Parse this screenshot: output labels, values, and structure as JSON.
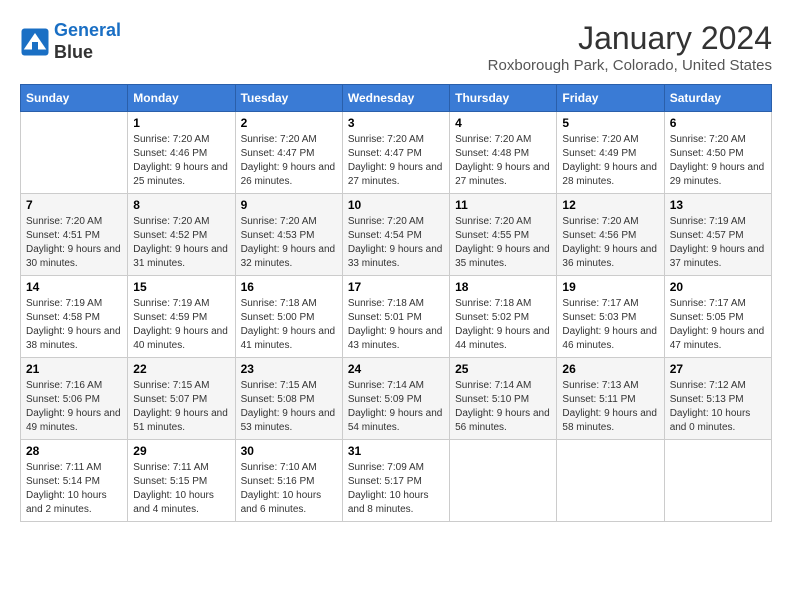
{
  "header": {
    "logo_line1": "General",
    "logo_line2": "Blue",
    "month_title": "January 2024",
    "location": "Roxborough Park, Colorado, United States"
  },
  "weekdays": [
    "Sunday",
    "Monday",
    "Tuesday",
    "Wednesday",
    "Thursday",
    "Friday",
    "Saturday"
  ],
  "weeks": [
    [
      {
        "day": "",
        "sunrise": "",
        "sunset": "",
        "daylight": ""
      },
      {
        "day": "1",
        "sunrise": "Sunrise: 7:20 AM",
        "sunset": "Sunset: 4:46 PM",
        "daylight": "Daylight: 9 hours and 25 minutes."
      },
      {
        "day": "2",
        "sunrise": "Sunrise: 7:20 AM",
        "sunset": "Sunset: 4:47 PM",
        "daylight": "Daylight: 9 hours and 26 minutes."
      },
      {
        "day": "3",
        "sunrise": "Sunrise: 7:20 AM",
        "sunset": "Sunset: 4:47 PM",
        "daylight": "Daylight: 9 hours and 27 minutes."
      },
      {
        "day": "4",
        "sunrise": "Sunrise: 7:20 AM",
        "sunset": "Sunset: 4:48 PM",
        "daylight": "Daylight: 9 hours and 27 minutes."
      },
      {
        "day": "5",
        "sunrise": "Sunrise: 7:20 AM",
        "sunset": "Sunset: 4:49 PM",
        "daylight": "Daylight: 9 hours and 28 minutes."
      },
      {
        "day": "6",
        "sunrise": "Sunrise: 7:20 AM",
        "sunset": "Sunset: 4:50 PM",
        "daylight": "Daylight: 9 hours and 29 minutes."
      }
    ],
    [
      {
        "day": "7",
        "sunrise": "Sunrise: 7:20 AM",
        "sunset": "Sunset: 4:51 PM",
        "daylight": "Daylight: 9 hours and 30 minutes."
      },
      {
        "day": "8",
        "sunrise": "Sunrise: 7:20 AM",
        "sunset": "Sunset: 4:52 PM",
        "daylight": "Daylight: 9 hours and 31 minutes."
      },
      {
        "day": "9",
        "sunrise": "Sunrise: 7:20 AM",
        "sunset": "Sunset: 4:53 PM",
        "daylight": "Daylight: 9 hours and 32 minutes."
      },
      {
        "day": "10",
        "sunrise": "Sunrise: 7:20 AM",
        "sunset": "Sunset: 4:54 PM",
        "daylight": "Daylight: 9 hours and 33 minutes."
      },
      {
        "day": "11",
        "sunrise": "Sunrise: 7:20 AM",
        "sunset": "Sunset: 4:55 PM",
        "daylight": "Daylight: 9 hours and 35 minutes."
      },
      {
        "day": "12",
        "sunrise": "Sunrise: 7:20 AM",
        "sunset": "Sunset: 4:56 PM",
        "daylight": "Daylight: 9 hours and 36 minutes."
      },
      {
        "day": "13",
        "sunrise": "Sunrise: 7:19 AM",
        "sunset": "Sunset: 4:57 PM",
        "daylight": "Daylight: 9 hours and 37 minutes."
      }
    ],
    [
      {
        "day": "14",
        "sunrise": "Sunrise: 7:19 AM",
        "sunset": "Sunset: 4:58 PM",
        "daylight": "Daylight: 9 hours and 38 minutes."
      },
      {
        "day": "15",
        "sunrise": "Sunrise: 7:19 AM",
        "sunset": "Sunset: 4:59 PM",
        "daylight": "Daylight: 9 hours and 40 minutes."
      },
      {
        "day": "16",
        "sunrise": "Sunrise: 7:18 AM",
        "sunset": "Sunset: 5:00 PM",
        "daylight": "Daylight: 9 hours and 41 minutes."
      },
      {
        "day": "17",
        "sunrise": "Sunrise: 7:18 AM",
        "sunset": "Sunset: 5:01 PM",
        "daylight": "Daylight: 9 hours and 43 minutes."
      },
      {
        "day": "18",
        "sunrise": "Sunrise: 7:18 AM",
        "sunset": "Sunset: 5:02 PM",
        "daylight": "Daylight: 9 hours and 44 minutes."
      },
      {
        "day": "19",
        "sunrise": "Sunrise: 7:17 AM",
        "sunset": "Sunset: 5:03 PM",
        "daylight": "Daylight: 9 hours and 46 minutes."
      },
      {
        "day": "20",
        "sunrise": "Sunrise: 7:17 AM",
        "sunset": "Sunset: 5:05 PM",
        "daylight": "Daylight: 9 hours and 47 minutes."
      }
    ],
    [
      {
        "day": "21",
        "sunrise": "Sunrise: 7:16 AM",
        "sunset": "Sunset: 5:06 PM",
        "daylight": "Daylight: 9 hours and 49 minutes."
      },
      {
        "day": "22",
        "sunrise": "Sunrise: 7:15 AM",
        "sunset": "Sunset: 5:07 PM",
        "daylight": "Daylight: 9 hours and 51 minutes."
      },
      {
        "day": "23",
        "sunrise": "Sunrise: 7:15 AM",
        "sunset": "Sunset: 5:08 PM",
        "daylight": "Daylight: 9 hours and 53 minutes."
      },
      {
        "day": "24",
        "sunrise": "Sunrise: 7:14 AM",
        "sunset": "Sunset: 5:09 PM",
        "daylight": "Daylight: 9 hours and 54 minutes."
      },
      {
        "day": "25",
        "sunrise": "Sunrise: 7:14 AM",
        "sunset": "Sunset: 5:10 PM",
        "daylight": "Daylight: 9 hours and 56 minutes."
      },
      {
        "day": "26",
        "sunrise": "Sunrise: 7:13 AM",
        "sunset": "Sunset: 5:11 PM",
        "daylight": "Daylight: 9 hours and 58 minutes."
      },
      {
        "day": "27",
        "sunrise": "Sunrise: 7:12 AM",
        "sunset": "Sunset: 5:13 PM",
        "daylight": "Daylight: 10 hours and 0 minutes."
      }
    ],
    [
      {
        "day": "28",
        "sunrise": "Sunrise: 7:11 AM",
        "sunset": "Sunset: 5:14 PM",
        "daylight": "Daylight: 10 hours and 2 minutes."
      },
      {
        "day": "29",
        "sunrise": "Sunrise: 7:11 AM",
        "sunset": "Sunset: 5:15 PM",
        "daylight": "Daylight: 10 hours and 4 minutes."
      },
      {
        "day": "30",
        "sunrise": "Sunrise: 7:10 AM",
        "sunset": "Sunset: 5:16 PM",
        "daylight": "Daylight: 10 hours and 6 minutes."
      },
      {
        "day": "31",
        "sunrise": "Sunrise: 7:09 AM",
        "sunset": "Sunset: 5:17 PM",
        "daylight": "Daylight: 10 hours and 8 minutes."
      },
      {
        "day": "",
        "sunrise": "",
        "sunset": "",
        "daylight": ""
      },
      {
        "day": "",
        "sunrise": "",
        "sunset": "",
        "daylight": ""
      },
      {
        "day": "",
        "sunrise": "",
        "sunset": "",
        "daylight": ""
      }
    ]
  ]
}
